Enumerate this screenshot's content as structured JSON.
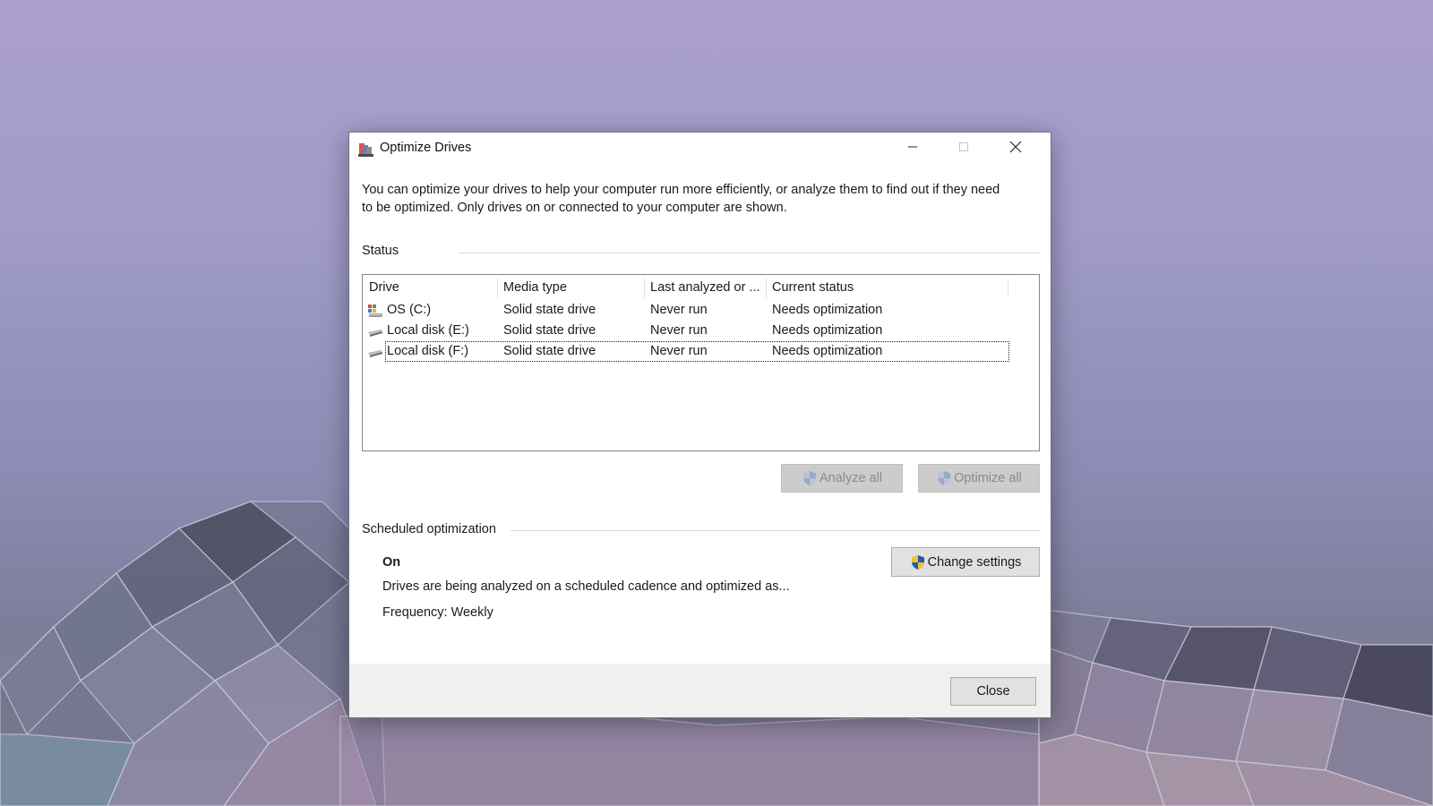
{
  "window": {
    "title": "Optimize Drives",
    "description": "You can optimize your drives to help your computer run more efficiently, or analyze them to find out if they need to be optimized. Only drives on or connected to your computer are shown."
  },
  "status": {
    "label": "Status",
    "columns": [
      "Drive",
      "Media type",
      "Last analyzed or ...",
      "Current status"
    ],
    "drives": [
      {
        "name": "OS (C:)",
        "media": "Solid state drive",
        "last": "Never run",
        "status": "Needs optimization",
        "icon": "os-drive-icon"
      },
      {
        "name": "Local disk (E:)",
        "media": "Solid state drive",
        "last": "Never run",
        "status": "Needs optimization",
        "icon": "disk-drive-icon"
      },
      {
        "name": "Local disk (F:)",
        "media": "Solid state drive",
        "last": "Never run",
        "status": "Needs optimization",
        "icon": "disk-drive-icon",
        "focused": true
      }
    ],
    "analyze_all": "Analyze all",
    "optimize_all": "Optimize all"
  },
  "scheduled": {
    "label": "Scheduled optimization",
    "state": "On",
    "description": "Drives are being analyzed on a scheduled cadence and optimized as...",
    "frequency": "Frequency: Weekly",
    "change_settings": "Change settings"
  },
  "footer": {
    "close": "Close"
  },
  "colors": {
    "shield_blue": "#1f5bb5",
    "shield_yellow": "#f2c12e",
    "disabled_button": "#cccccc"
  }
}
